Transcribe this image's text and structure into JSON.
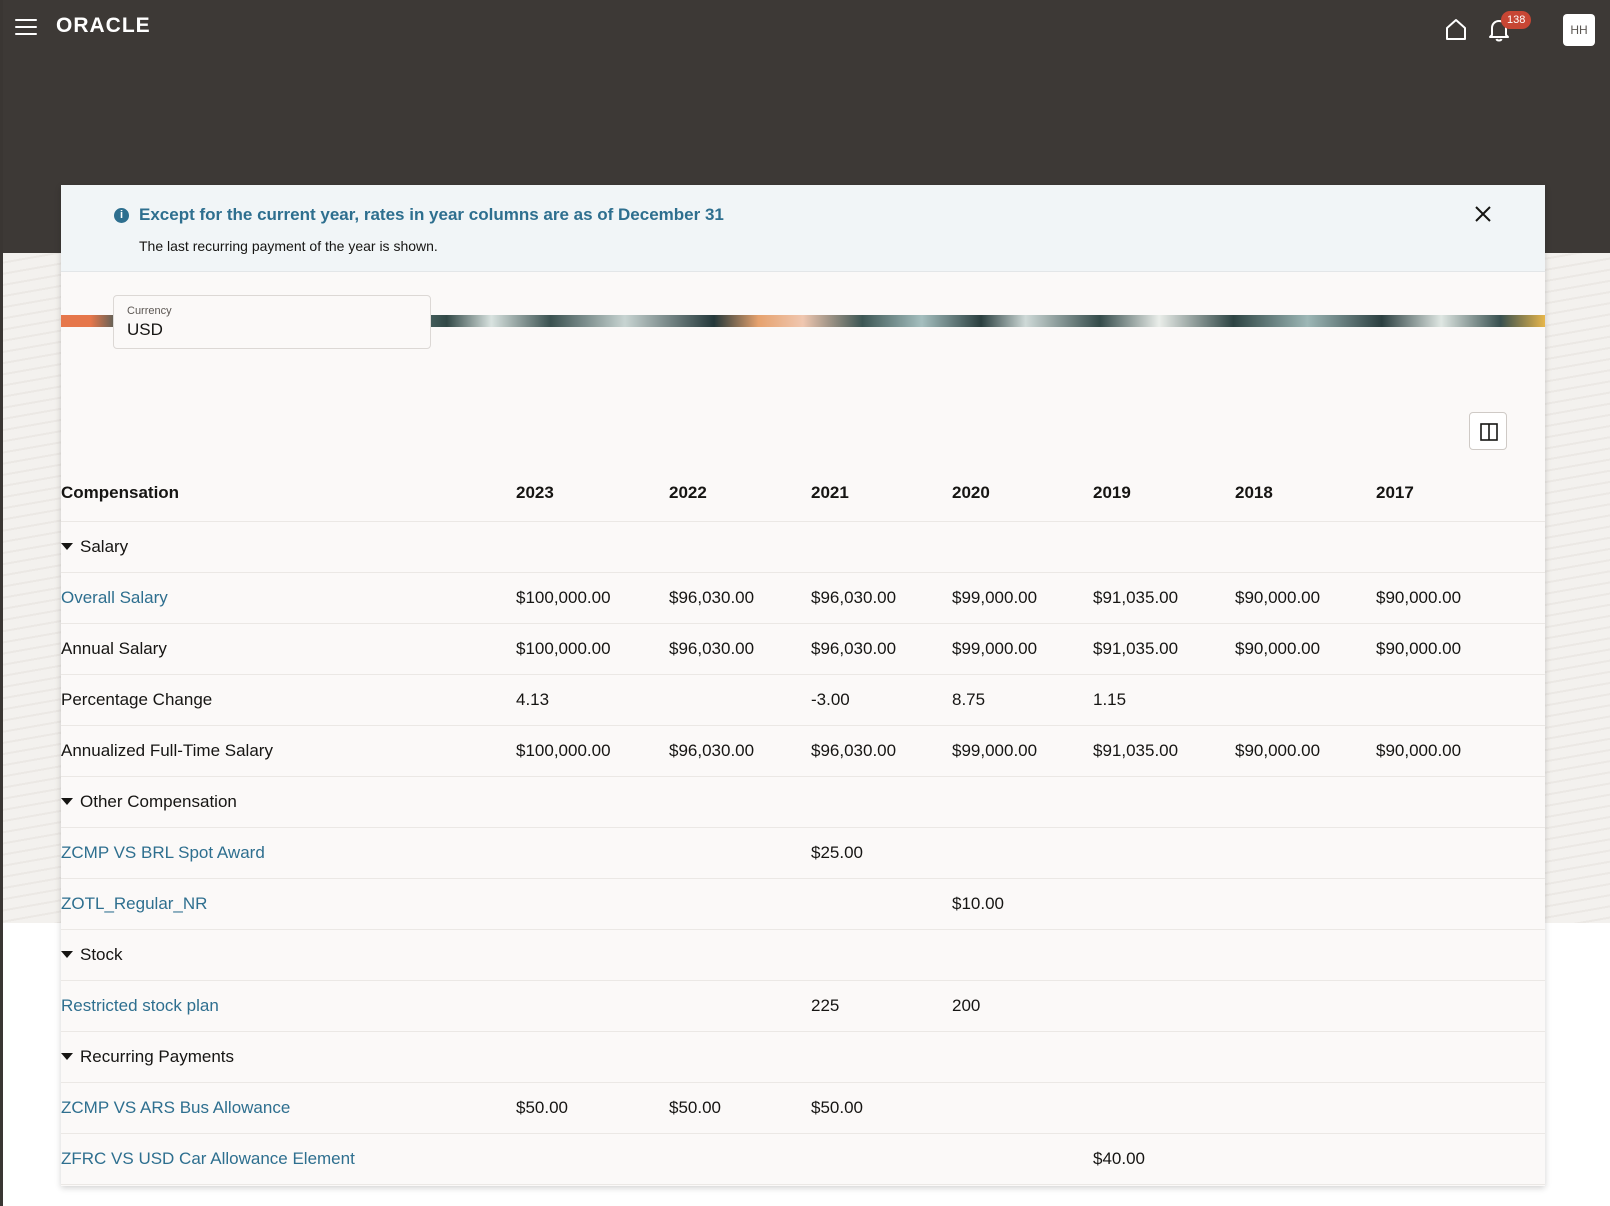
{
  "header": {
    "brand": "ORACLE",
    "notification_count": "138",
    "avatar_initials": "HH"
  },
  "banner": {
    "title": "Except for the current year, rates in year columns are as of December 31",
    "subtitle": "The last recurring payment of the year is shown."
  },
  "currency": {
    "label": "Currency",
    "value": "USD"
  },
  "table": {
    "headers": [
      "Compensation",
      "2023",
      "2022",
      "2021",
      "2020",
      "2019",
      "2018",
      "2017"
    ],
    "groups": [
      {
        "label": "Salary",
        "rows": [
          {
            "label": "Overall Salary",
            "link": true,
            "cells": [
              "$100,000.00",
              "$96,030.00",
              "$96,030.00",
              "$99,000.00",
              "$91,035.00",
              "$90,000.00",
              "$90,000.00"
            ]
          },
          {
            "label": "Annual Salary",
            "link": false,
            "cells": [
              "$100,000.00",
              "$96,030.00",
              "$96,030.00",
              "$99,000.00",
              "$91,035.00",
              "$90,000.00",
              "$90,000.00"
            ]
          },
          {
            "label": "Percentage Change",
            "link": false,
            "cells": [
              "4.13",
              "",
              "-3.00",
              "8.75",
              "1.15",
              "",
              ""
            ]
          },
          {
            "label": "Annualized Full-Time Salary",
            "link": false,
            "cells": [
              "$100,000.00",
              "$96,030.00",
              "$96,030.00",
              "$99,000.00",
              "$91,035.00",
              "$90,000.00",
              "$90,000.00"
            ]
          }
        ]
      },
      {
        "label": "Other Compensation",
        "rows": [
          {
            "label": "ZCMP VS BRL Spot Award",
            "link": true,
            "cells": [
              "",
              "",
              "$25.00",
              "",
              "",
              "",
              ""
            ]
          },
          {
            "label": "ZOTL_Regular_NR",
            "link": true,
            "cells": [
              "",
              "",
              "",
              "$10.00",
              "",
              "",
              ""
            ]
          }
        ]
      },
      {
        "label": "Stock",
        "rows": [
          {
            "label": "Restricted stock plan",
            "link": true,
            "cells": [
              "",
              "",
              "225",
              "200",
              "",
              "",
              ""
            ]
          }
        ]
      },
      {
        "label": "Recurring Payments",
        "rows": [
          {
            "label": "ZCMP VS ARS Bus Allowance",
            "link": true,
            "cells": [
              "$50.00",
              "$50.00",
              "$50.00",
              "",
              "",
              "",
              ""
            ]
          },
          {
            "label": "ZFRC VS USD Car Allowance Element",
            "link": true,
            "cells": [
              "",
              "",
              "",
              "",
              "$40.00",
              "",
              ""
            ]
          }
        ]
      }
    ]
  },
  "icons": {
    "menu": "hamburger-menu-icon",
    "home": "home-icon",
    "notifications": "bell-icon",
    "info": "info-icon",
    "close": "close-icon",
    "columns": "columns-icon",
    "expand": "caret-down-icon"
  },
  "colors": {
    "header_bg": "#3d3936",
    "link": "#2e6f8f",
    "badge": "#c74634",
    "banner_bg": "#f1f5f7"
  }
}
